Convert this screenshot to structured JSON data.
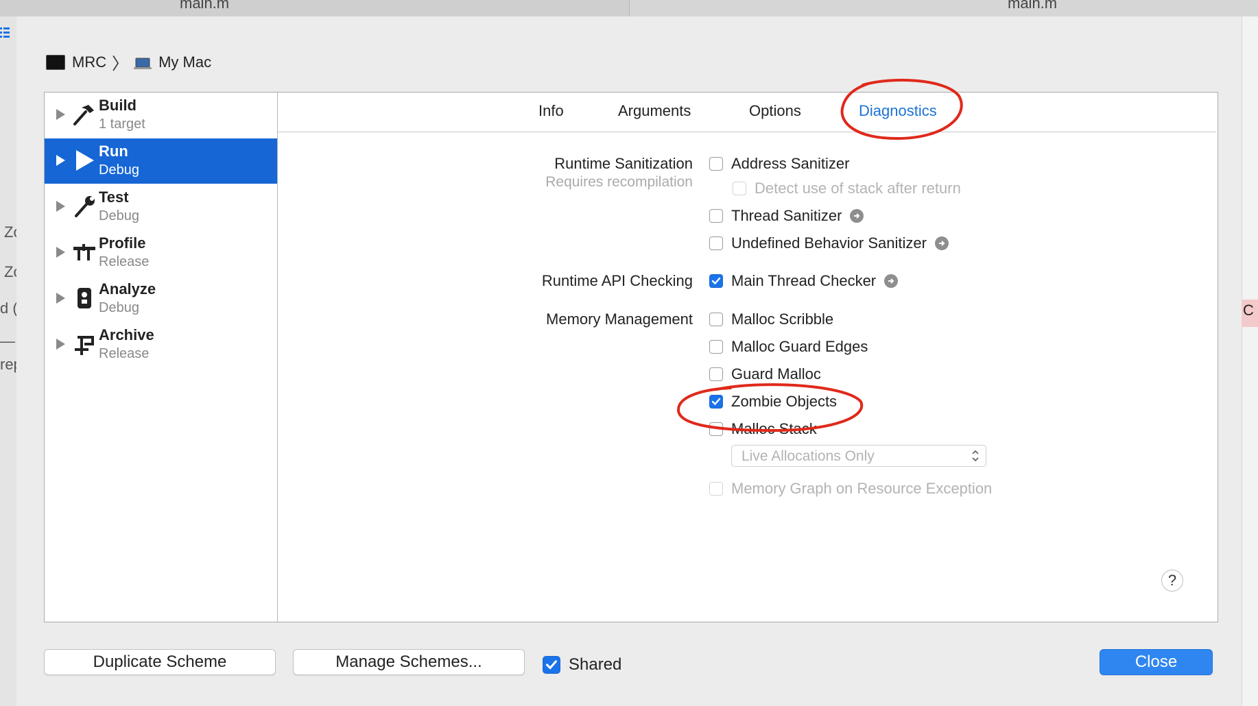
{
  "background": {
    "tab_left_title": "main.m",
    "tab_right_title": "main.m",
    "left_fragments": [
      "Zc",
      "Zc",
      "d (",
      "—",
      "rep"
    ],
    "right_fragment": "C"
  },
  "breadcrumb": {
    "scheme": "MRC",
    "separator": "〉",
    "destination": "My Mac"
  },
  "sidebar": {
    "items": [
      {
        "title": "Build",
        "subtitle": "1 target",
        "icon": "hammer-icon"
      },
      {
        "title": "Run",
        "subtitle": "Debug",
        "icon": "play-icon",
        "selected": true
      },
      {
        "title": "Test",
        "subtitle": "Debug",
        "icon": "wrench-icon"
      },
      {
        "title": "Profile",
        "subtitle": "Release",
        "icon": "instruments-icon"
      },
      {
        "title": "Analyze",
        "subtitle": "Debug",
        "icon": "analyze-icon"
      },
      {
        "title": "Archive",
        "subtitle": "Release",
        "icon": "archive-icon"
      }
    ]
  },
  "tabs": [
    {
      "label": "Info"
    },
    {
      "label": "Arguments"
    },
    {
      "label": "Options"
    },
    {
      "label": "Diagnostics",
      "active": true
    }
  ],
  "diagnostics": {
    "runtime_sanitization": {
      "label": "Runtime Sanitization",
      "note": "Requires recompilation",
      "address_sanitizer": "Address Sanitizer",
      "detect_stack": "Detect use of stack after return",
      "thread_sanitizer": "Thread Sanitizer",
      "undefined_behavior": "Undefined Behavior Sanitizer"
    },
    "runtime_api": {
      "label": "Runtime API Checking",
      "main_thread_checker": "Main Thread Checker"
    },
    "memory_management": {
      "label": "Memory Management",
      "malloc_scribble": "Malloc Scribble",
      "malloc_guard_edges": "Malloc Guard Edges",
      "guard_malloc": "Guard Malloc",
      "zombie_objects": "Zombie Objects",
      "malloc_stack": "Malloc Stack",
      "malloc_stack_mode": "Live Allocations Only",
      "memory_graph": "Memory Graph on Resource Exception"
    },
    "checked": [
      "Main Thread Checker",
      "Zombie Objects"
    ]
  },
  "help": {
    "label": "?"
  },
  "footer": {
    "duplicate": "Duplicate Scheme",
    "manage": "Manage Schemes...",
    "shared": "Shared",
    "close": "Close"
  },
  "colors": {
    "accent": "#1a73e8",
    "selection": "#1666d6",
    "annotation": "#e0291b"
  }
}
